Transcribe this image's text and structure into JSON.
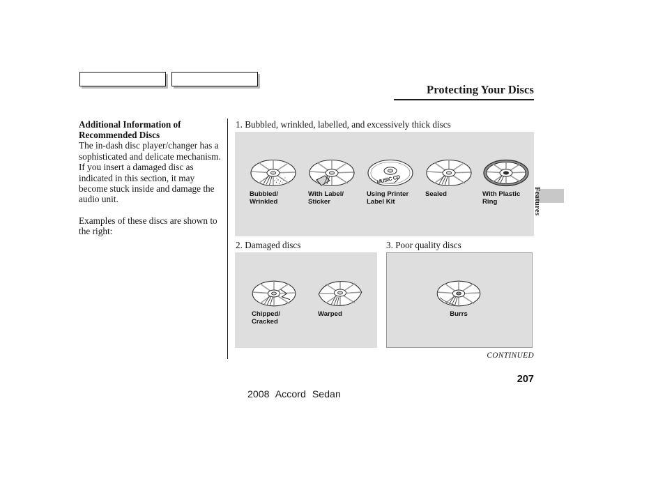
{
  "header": {
    "title": "Protecting Your Discs",
    "nav_boxes": [
      "",
      ""
    ]
  },
  "left_column": {
    "heading": "Additional Information of Recommended Discs",
    "paragraph_1": "The in-dash disc player/changer has a sophisticated and delicate mechanism. If you insert a damaged disc as indicated in this section, it may become stuck inside and damage the audio unit.",
    "paragraph_2": "Examples of these discs are shown to the right:"
  },
  "panels": [
    {
      "caption": "1. Bubbled, wrinkled, labelled, and excessively thick discs",
      "items": [
        {
          "label": "Bubbled/\nWrinkled",
          "art": "disc-bubbled"
        },
        {
          "label": "With Label/\nSticker",
          "art": "disc-label-sticker"
        },
        {
          "label": "Using Printer\nLabel Kit",
          "art": "disc-printer-kit"
        },
        {
          "label": "Sealed",
          "art": "disc-sealed"
        },
        {
          "label": "With Plastic\nRing",
          "art": "disc-plastic-ring"
        }
      ]
    },
    {
      "caption": "2. Damaged discs",
      "items": [
        {
          "label": "Chipped/\nCracked",
          "art": "disc-chipped-cracked"
        },
        {
          "label": "Warped",
          "art": "disc-warped"
        }
      ]
    },
    {
      "caption": "3. Poor quality discs",
      "items": [
        {
          "label": "Burrs",
          "art": "disc-burrs"
        }
      ]
    }
  ],
  "side_tab": {
    "label": "Features"
  },
  "footer": {
    "continued": "CONTINUED",
    "page_number": "207",
    "document": "2008 Accord Sedan"
  },
  "colors": {
    "panel_background": "#dedede",
    "side_tab_block": "#c8c8c8",
    "text": "#141414"
  }
}
